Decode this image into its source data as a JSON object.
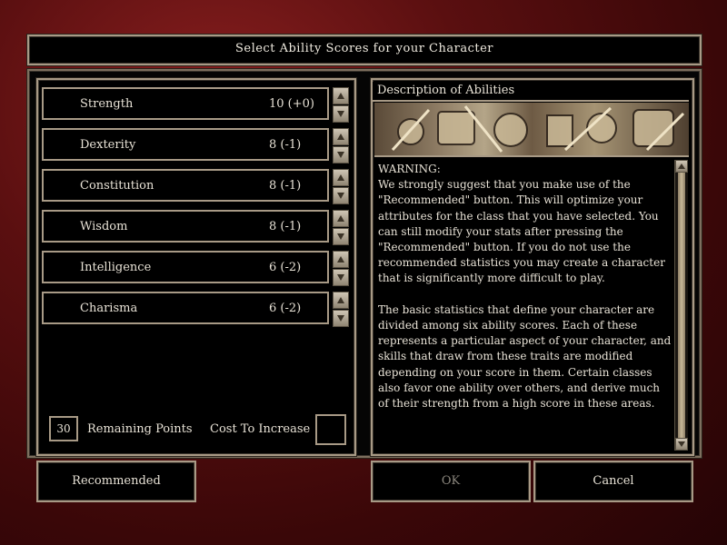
{
  "title": "Select Ability Scores for your Character",
  "abilities": [
    {
      "name": "Strength",
      "score": "10 (+0)"
    },
    {
      "name": "Dexterity",
      "score": "8 (-1)"
    },
    {
      "name": "Constitution",
      "score": "8 (-1)"
    },
    {
      "name": "Wisdom",
      "score": "8 (-1)"
    },
    {
      "name": "Intelligence",
      "score": "6 (-2)"
    },
    {
      "name": "Charisma",
      "score": "6 (-2)"
    }
  ],
  "points": {
    "remaining_value": "30",
    "remaining_label": "Remaining Points",
    "cost_label": "Cost To Increase",
    "cost_value": ""
  },
  "description": {
    "header": "Description of Abilities",
    "text": "WARNING:\nWe strongly suggest that you make use of the \"Recommended\" button. This will optimize your attributes for the class that you have selected. You can still modify your stats after pressing the \"Recommended\" button. If you do not use the recommended statistics you may create a character that is significantly more difficult to play.\n\nThe basic statistics that define your character are divided among six ability scores. Each of these represents a particular aspect of your character, and skills that draw from these traits are modified depending on your score in them. Certain classes also favor one ability over others, and derive much of their strength from a high score in these areas."
  },
  "buttons": {
    "recommended": "Recommended",
    "ok": "OK",
    "cancel": "Cancel"
  },
  "colors": {
    "background_red": "#5a0f10",
    "panel": "#000000",
    "border_stone": "#a89a86",
    "text": "#e8e2d6",
    "disabled_text": "#8a857c"
  },
  "icons": {
    "spin_up": "triangle-up-icon",
    "spin_down": "triangle-down-icon"
  }
}
